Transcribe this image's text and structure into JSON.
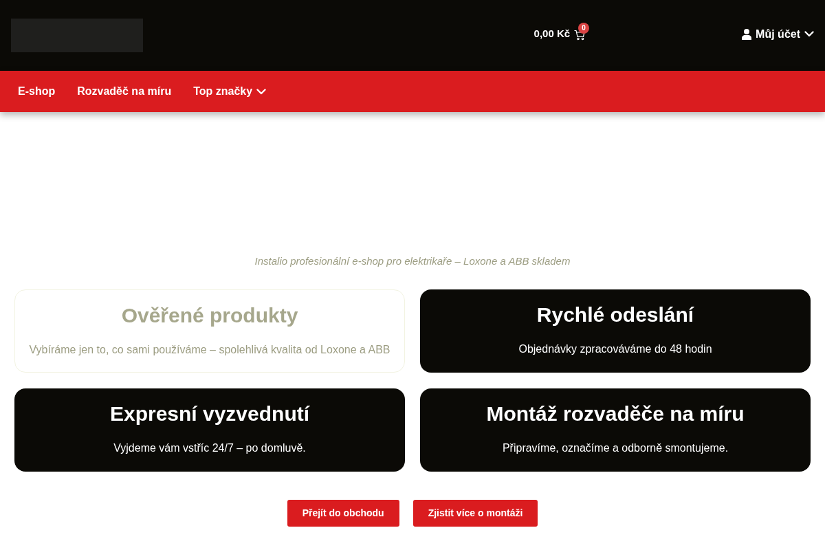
{
  "cart": {
    "total": "0,00 Kč",
    "count": "0"
  },
  "account": {
    "label": "Můj účet"
  },
  "nav": [
    {
      "label": "E-shop",
      "has_dropdown": false
    },
    {
      "label": "Rozvaděč na míru",
      "has_dropdown": false
    },
    {
      "label": "Top značky",
      "has_dropdown": true
    }
  ],
  "tagline": "Instalio profesionální e-shop pro elektrikaře – Loxone a ABB skladem",
  "features": [
    {
      "kind": "faint",
      "title": "Ověřené produkty",
      "text": "Vybíráme jen to, co sami používáme – spolehlivá kvalita od Loxone a ABB"
    },
    {
      "kind": "dark",
      "title": "Rychlé odeslání",
      "text": "Objednávky zpracováváme do 48 hodin"
    },
    {
      "kind": "dark",
      "title": "Expresní vyzvednutí",
      "text": "Vyjdeme vám vstříc 24/7 – po domluvě."
    },
    {
      "kind": "dark",
      "title": "Montáž rozvaděče na míru",
      "text": "Připravíme, označíme a odborně smontujeme."
    }
  ],
  "buttons": [
    "Přejít do obchodu",
    "Zjistit více o montáži"
  ]
}
